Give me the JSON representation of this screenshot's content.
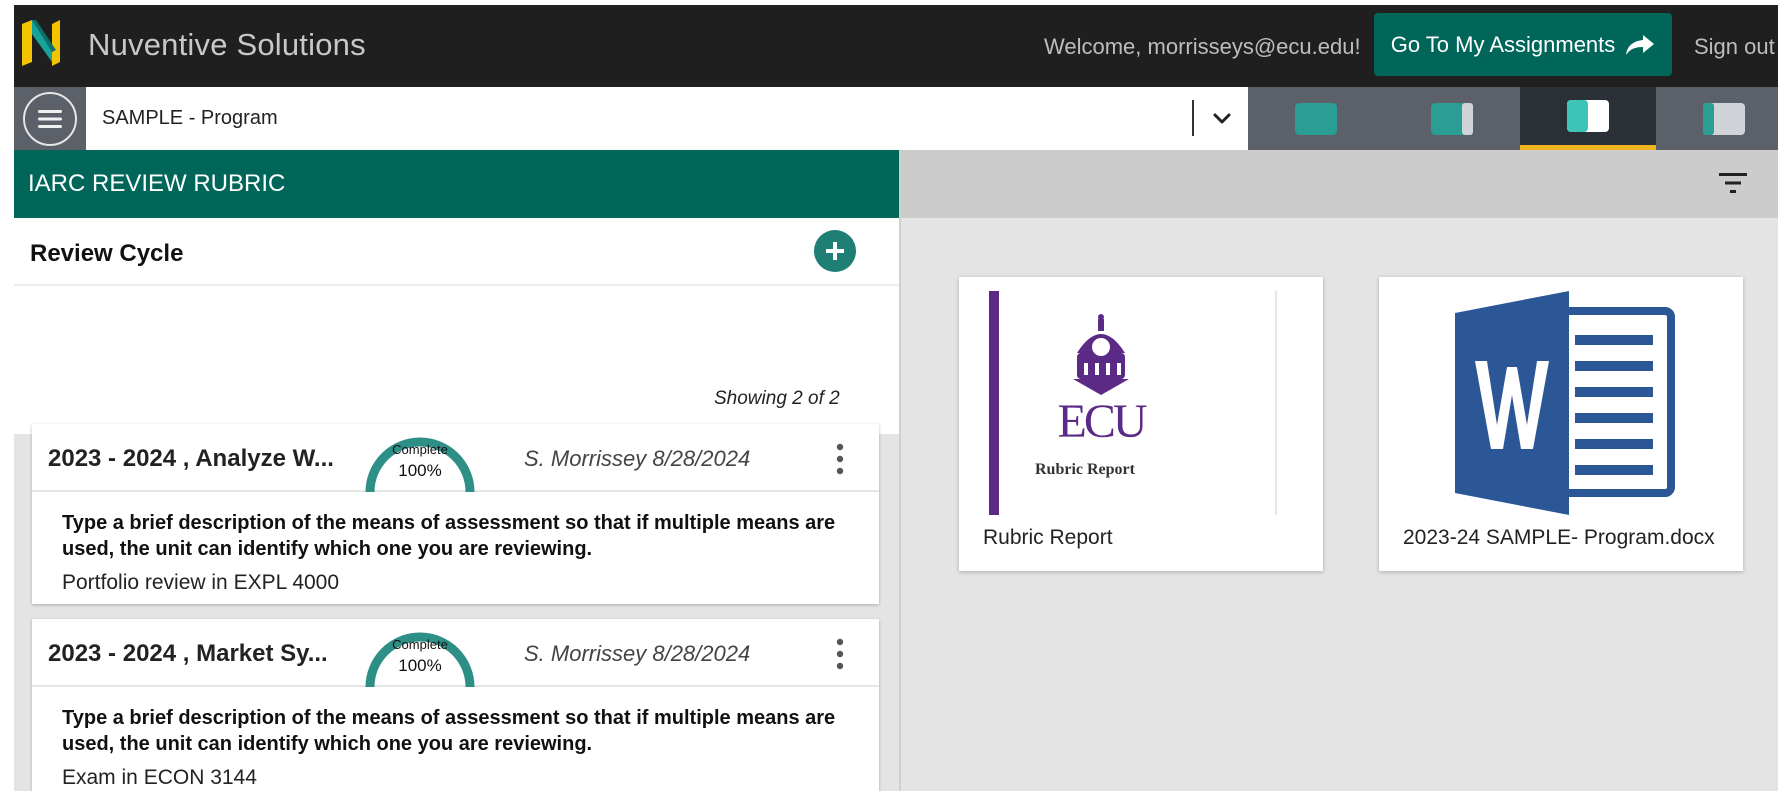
{
  "header": {
    "app_title": "Nuventive Solutions",
    "welcome": "Welcome, morrisseys@ecu.edu!",
    "assignments_button": "Go To My Assignments",
    "sign_out": "Sign out",
    "brand_color": "#00665a"
  },
  "navbar": {
    "program_select": "SAMPLE - Program",
    "layout_buttons": [
      "left-panel-only",
      "mostly-left-panel",
      "split-panel",
      "mostly-right-panel"
    ],
    "active_layout": "split-panel",
    "active_color": "#f0b41c"
  },
  "left_panel": {
    "title": "IARC REVIEW RUBRIC",
    "section_title": "Review Cycle",
    "showing": "Showing 2 of 2",
    "cards": [
      {
        "title": "2023 - 2024 , Analyze W...",
        "status_label": "Complete",
        "status_pct": "100%",
        "progress": 1.0,
        "author": "S. Morrissey 8/28/2024",
        "question": "Type a brief description of the means of assessment so that if multiple means are used, the unit can identify which one you are reviewing.",
        "answer": "Portfolio review in EXPL 4000"
      },
      {
        "title": "2023 - 2024 , Market Sy...",
        "status_label": "Complete",
        "status_pct": "100%",
        "progress": 1.0,
        "author": "S. Morrissey 8/28/2024",
        "question": "Type a brief description of the means of assessment so that if multiple means are used, the unit can identify which one you are reviewing.",
        "answer": "Exam in ECON 3144"
      }
    ]
  },
  "right_panel": {
    "documents": [
      {
        "thumb_logo": "ECU",
        "thumb_caption": "Rubric Report",
        "label": "Rubric Report",
        "icon": "ecu-logo-icon"
      },
      {
        "label": "2023-24 SAMPLE- Program.docx",
        "icon": "word-document-icon"
      }
    ]
  }
}
